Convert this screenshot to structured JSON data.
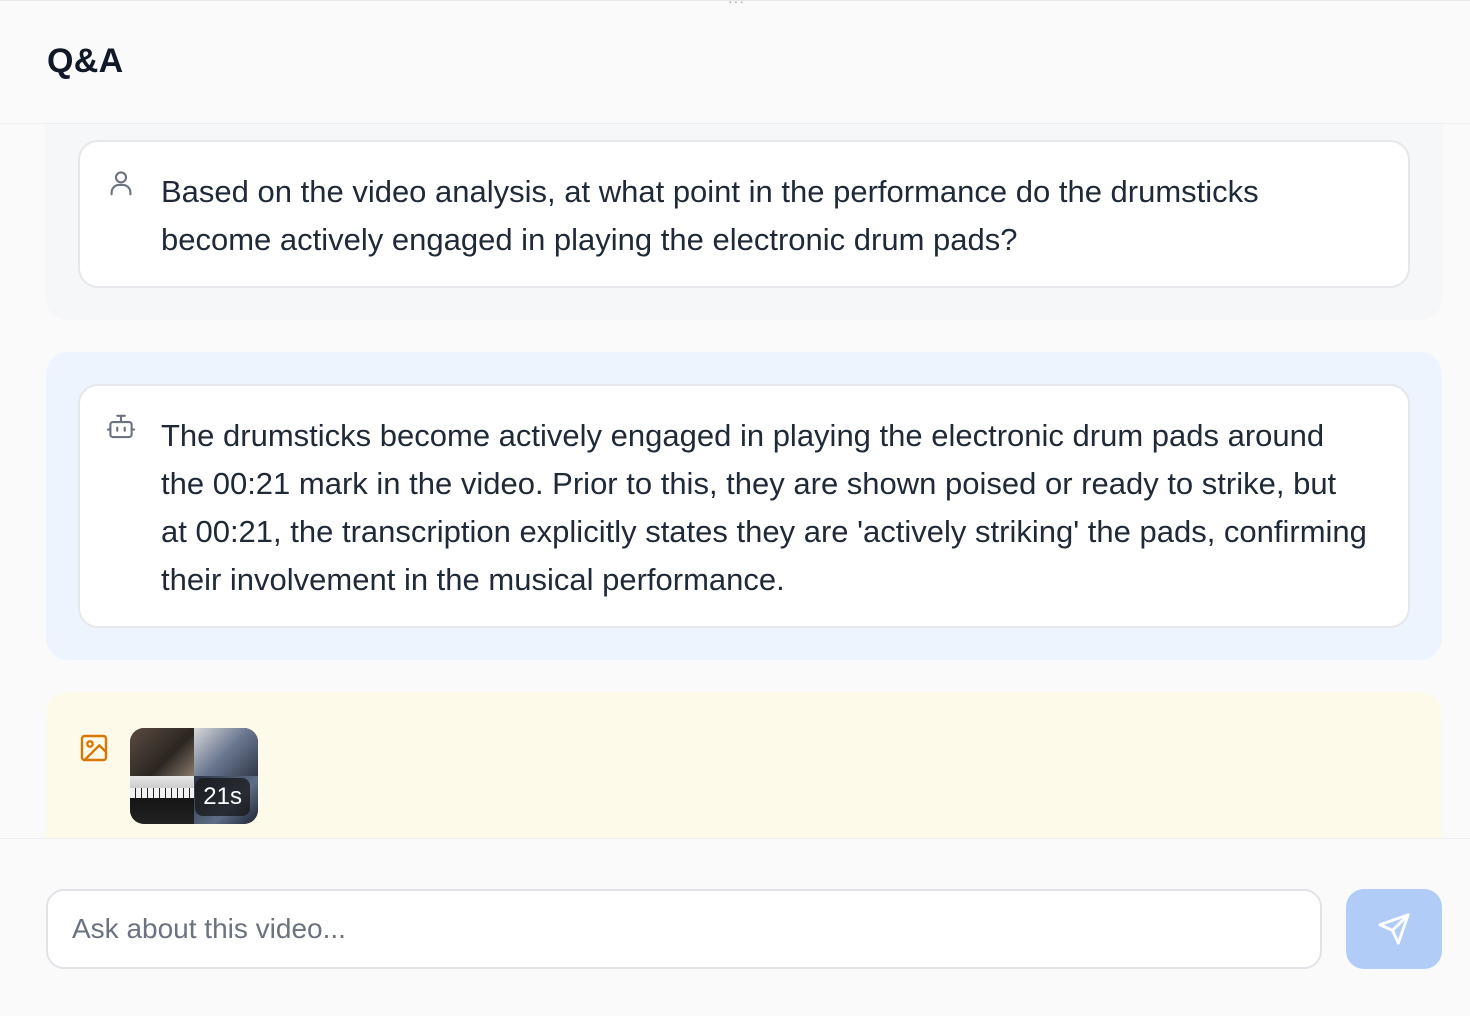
{
  "header": {
    "title": "Q&A"
  },
  "messages": {
    "user": {
      "icon": "user-icon",
      "text": "Based on the video analysis, at what point in the performance do the drumsticks become actively engaged in playing the electronic drum pads?"
    },
    "assistant": {
      "icon": "bot-icon",
      "text": "The drumsticks become actively engaged in playing the electronic drum pads around the 00:21 mark in the video. Prior to this, they are shown poised or ready to strike, but at 00:21, the transcription explicitly states they are 'actively striking' the pads, confirming their involvement in the musical performance."
    },
    "image": {
      "icon": "image-icon",
      "thumbnail_badge": "21s"
    }
  },
  "composer": {
    "placeholder": "Ask about this video...",
    "value": "",
    "send_icon": "send-icon"
  },
  "colors": {
    "user_bg": "#f6f7f9",
    "assistant_bg": "#eef4fd",
    "image_bg": "#fefaea",
    "image_icon": "#d97706",
    "send_button": "#b1cdf7"
  }
}
